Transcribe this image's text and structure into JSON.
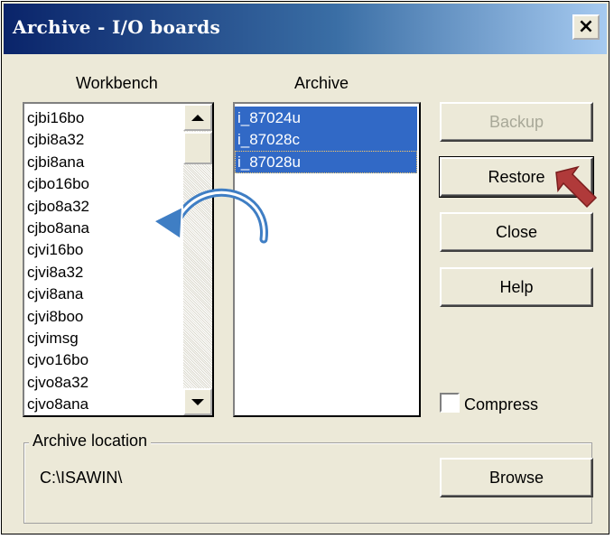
{
  "window": {
    "title": "Archive - I/O boards",
    "close_glyph": "×"
  },
  "workbench": {
    "label": "Workbench",
    "items": [
      "cjbi16bo",
      "cjbi8a32",
      "cjbi8ana",
      "cjbo16bo",
      "cjbo8a32",
      "cjbo8ana",
      "cjvi16bo",
      "cjvi8a32",
      "cjvi8ana",
      "cjvi8boo",
      "cjvimsg",
      "cjvo16bo",
      "cjvo8a32",
      "cjvo8ana"
    ]
  },
  "archive": {
    "label": "Archive",
    "items": [
      "i_87024u",
      "i_87028c",
      "i_87028u"
    ]
  },
  "buttons": {
    "backup": {
      "label": "Backup",
      "enabled": false
    },
    "restore": {
      "label": "Restore"
    },
    "close": {
      "label": "Close"
    },
    "help": {
      "label": "Help"
    },
    "browse": {
      "label": "Browse"
    }
  },
  "compress": {
    "label": "Compress",
    "checked": false
  },
  "location": {
    "legend": "Archive location",
    "path": "C:\\ISAWIN\\"
  },
  "colors": {
    "selection": "#3169c6",
    "annotation_arrow": "#3f7ec4",
    "pointer_arrow": "#b03a3a"
  },
  "icons": {
    "restore_pointer": "pointer-arrow-icon",
    "transfer": "curved-arrow-icon"
  }
}
